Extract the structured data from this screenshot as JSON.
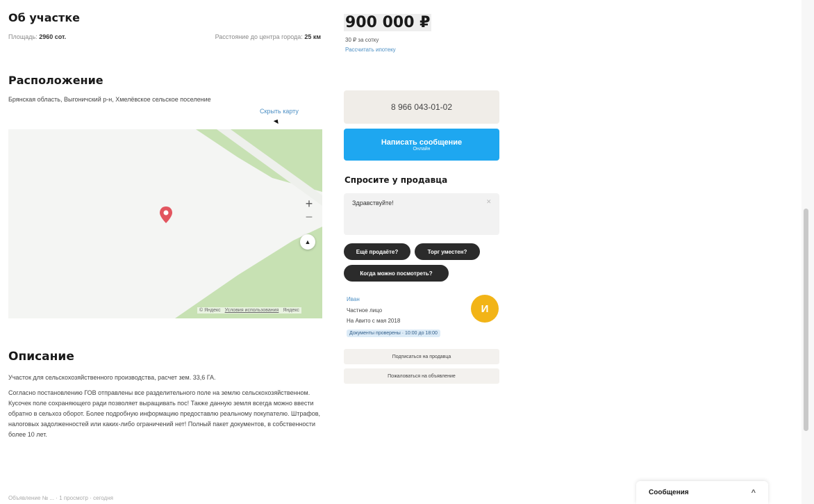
{
  "about": {
    "title": "Об участке",
    "area_label": "Площадь:",
    "area_value": "2960 сот.",
    "distance_label": "Расстояние до центра города:",
    "distance_value": "25 км"
  },
  "location": {
    "title": "Расположение",
    "address": "Брянская область, Выгоничский р-н, Хмелёвское сельское поселение",
    "hide_map": "Скрыть карту",
    "map_footer_brand": "© Яндекс",
    "map_footer_terms": "Условия использования",
    "map_footer_more": "Яндекс"
  },
  "description": {
    "title": "Описание",
    "p1": "Участок для сельскохозяйственного производства, расчет зем. 33,6 ГА.",
    "p2": "Согласно постановлению ГОВ отправлены все разделительного поле на землю сельскохозяйственном. Кусочек поле сохраняющего ради позволяет выращивать пос! Также данную земля всегда можно ввести обратно в сельхоз оборот. Более подробную информацию предоставлю реальному покупателю. Штрафов, налоговых задолженностей или каких-либо ограничений нет! Полный пакет документов, в собственности более 10 лет."
  },
  "bottom_strip": "Объявление № ... · 1 просмотр · сегодня",
  "price": {
    "value": "900 000 ₽",
    "per_unit": "30 ₽ за сотку",
    "link": "Рассчитать ипотеку"
  },
  "phone": "8 966 043-01-02",
  "message_button": {
    "label": "Написать сообщение",
    "sub": "Онлайн"
  },
  "ask": {
    "title": "Спросите у продавца",
    "placeholder_text": "Здравствуйте!",
    "close_glyph": "✕",
    "chips": [
      "Ещё продаёте?",
      "Торг уместен?",
      "Когда можно посмотреть?"
    ]
  },
  "seller": {
    "name": "Иван",
    "type": "Частное лицо",
    "since": "На Авито с мая 2018",
    "badge": "Документы проверены · 10:00 до 18:00",
    "avatar_initials": "И"
  },
  "subscribe": "Подписаться на продавца",
  "complain": "Пожаловаться на объявление",
  "messages_widget": {
    "label": "Сообщения",
    "chevron": "^"
  },
  "map_controls": {
    "plus": "+",
    "minus": "−",
    "compass": "▲"
  },
  "colors": {
    "accent_blue": "#1ea7f0",
    "avatar_yellow": "#f2b417",
    "map_green": "#c7e1b3",
    "pin_red": "#e2555f"
  }
}
